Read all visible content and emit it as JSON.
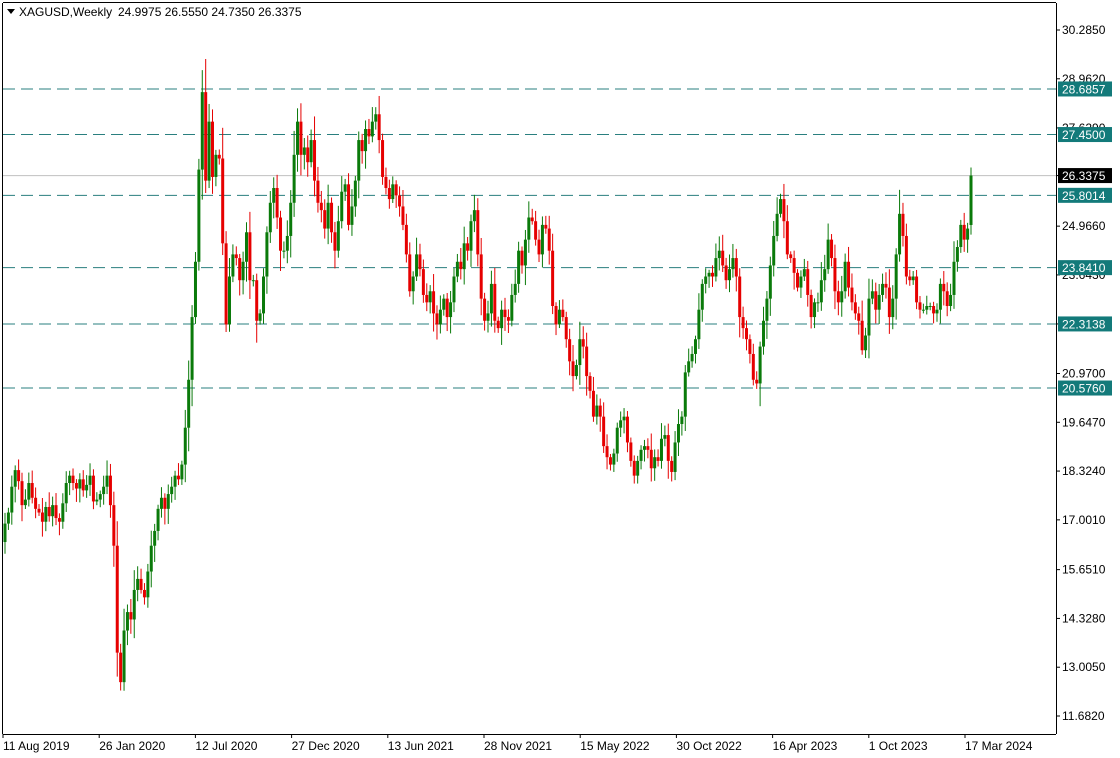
{
  "header": {
    "symbol": "XAGUSD,Weekly",
    "ohlc": "24.9975 26.5550 24.7350 26.3375"
  },
  "colors": {
    "up": "#0a7a0a",
    "down": "#e60000",
    "level_line": "#2a7f7f",
    "level_tag": "#137a7a",
    "current_tag": "#000000",
    "grid_frame": "#000000"
  },
  "chart_data": {
    "type": "candlestick",
    "title": "XAGUSD,Weekly",
    "timeframe": "Weekly",
    "last_ohlc": {
      "open": 24.9975,
      "high": 26.555,
      "low": 24.735,
      "close": 26.3375
    },
    "current_price": 26.3375,
    "y_range": [
      11.2,
      30.7
    ],
    "y_tick_labels": [
      30.285,
      28.962,
      27.629,
      26.3375,
      24.966,
      23.643,
      22.3138,
      20.97,
      19.647,
      18.324,
      17.001,
      15.651,
      14.328,
      13.005,
      11.682
    ],
    "x_tick_labels": [
      "11 Aug 2019",
      "26 Jan 2020",
      "12 Jul 2020",
      "27 Dec 2020",
      "13 Jun 2021",
      "28 Nov 2021",
      "15 May 2022",
      "30 Oct 2022",
      "16 Apr 2023",
      "1 Oct 2023",
      "17 Mar 2024"
    ],
    "horizontal_levels": [
      28.6857,
      27.45,
      25.8014,
      23.841,
      22.3138,
      20.576
    ],
    "horizontal_level_labels": [
      "28.6857",
      "27.4500",
      "25.8014",
      "23.8410",
      "22.3138",
      "20.5760"
    ],
    "weekly_closes": [
      16.9,
      17.2,
      17.9,
      18.35,
      18.05,
      17.4,
      17.55,
      18.0,
      17.6,
      17.3,
      17.2,
      16.95,
      17.35,
      17.1,
      17.4,
      17.05,
      16.95,
      17.45,
      18.0,
      18.2,
      18.0,
      17.85,
      18.1,
      17.8,
      17.95,
      18.2,
      17.5,
      17.55,
      17.7,
      17.9,
      18.2,
      17.4,
      16.3,
      13.4,
      12.6,
      14.0,
      14.5,
      14.3,
      15.1,
      15.4,
      15.1,
      14.9,
      15.6,
      16.3,
      16.7,
      17.3,
      17.6,
      17.3,
      17.7,
      17.9,
      18.2,
      18.1,
      18.5,
      19.5,
      20.8,
      22.5,
      24.0,
      26.5,
      28.6,
      26.2,
      27.8,
      26.3,
      26.9,
      26.8,
      24.5,
      22.3,
      23.6,
      24.2,
      24.1,
      23.5,
      24.0,
      24.8,
      23.5,
      23.5,
      22.4,
      22.6,
      23.6,
      24.8,
      25.6,
      26.0,
      25.2,
      24.3,
      24.3,
      24.7,
      25.6,
      26.9,
      27.8,
      26.9,
      27.1,
      26.7,
      27.3,
      26.2,
      25.6,
      25.4,
      24.9,
      25.6,
      24.8,
      24.3,
      25.1,
      25.9,
      26.1,
      25.0,
      25.5,
      26.2,
      27.3,
      27.0,
      27.6,
      27.4,
      27.8,
      28.0,
      27.3,
      26.3,
      26.0,
      25.7,
      26.1,
      25.8,
      25.5,
      25.0,
      24.2,
      23.2,
      23.6,
      24.2,
      23.8,
      23.1,
      22.9,
      23.2,
      22.6,
      22.3,
      22.7,
      23.0,
      22.5,
      22.9,
      23.6,
      24.0,
      23.8,
      24.5,
      24.3,
      25.1,
      25.4,
      24.2,
      23.0,
      22.4,
      22.6,
      23.4,
      22.4,
      22.2,
      22.7,
      22.5,
      22.4,
      23.1,
      23.4,
      24.3,
      23.9,
      24.6,
      25.2,
      25.1,
      24.6,
      24.2,
      25.0,
      24.9,
      24.3,
      22.8,
      22.3,
      22.7,
      22.5,
      21.9,
      21.3,
      20.9,
      21.2,
      21.9,
      21.7,
      20.9,
      20.5,
      19.8,
      20.1,
      19.8,
      19.0,
      18.7,
      18.5,
      18.8,
      19.5,
      19.7,
      19.8,
      19.1,
      18.6,
      18.2,
      18.6,
      18.9,
      19.0,
      18.9,
      18.4,
      18.7,
      18.6,
      19.2,
      19.3,
      18.6,
      18.3,
      19.1,
      19.6,
      19.8,
      21.0,
      21.3,
      21.5,
      21.9,
      22.7,
      23.4,
      23.6,
      23.7,
      23.6,
      24.1,
      24.3,
      23.9,
      23.5,
      23.8,
      24.1,
      23.6,
      22.5,
      22.2,
      21.9,
      21.5,
      20.8,
      20.7,
      21.7,
      22.4,
      23.0,
      23.9,
      24.7,
      25.3,
      25.7,
      25.1,
      24.2,
      24.1,
      23.7,
      23.3,
      23.6,
      23.8,
      23.1,
      22.5,
      22.9,
      22.9,
      23.5,
      23.8,
      24.6,
      24.1,
      23.2,
      22.9,
      23.2,
      24.0,
      23.3,
      22.9,
      22.6,
      22.4,
      21.6,
      22.0,
      23.0,
      23.2,
      22.7,
      23.1,
      23.4,
      23.3,
      22.5,
      23.0,
      24.2,
      25.3,
      24.7,
      23.6,
      23.5,
      23.6,
      22.9,
      22.7,
      22.7,
      22.8,
      22.8,
      22.6,
      22.7,
      23.4,
      23.2,
      22.8,
      23.1,
      24.0,
      24.4,
      25.0,
      24.6,
      24.9,
      26.3375
    ]
  }
}
